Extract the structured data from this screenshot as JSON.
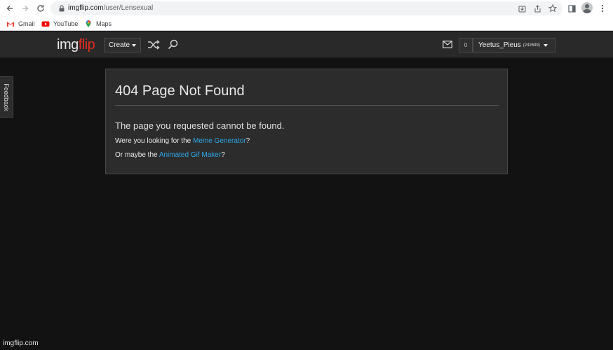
{
  "browser": {
    "url_domain": "imgflip.com",
    "url_path": "/user/Lensexual",
    "bookmarks": [
      {
        "label": "Gmail",
        "icon": "gmail-icon"
      },
      {
        "label": "YouTube",
        "icon": "youtube-icon"
      },
      {
        "label": "Maps",
        "icon": "maps-icon"
      }
    ]
  },
  "site": {
    "logo_img": "img",
    "logo_flip": "flip",
    "create_label": "Create",
    "notification_count": "0",
    "username": "Yeetus_Pieus",
    "user_points": "(242699)",
    "feedback_label": "Feedback",
    "colors": {
      "logo_red": "#e02d1e",
      "link_blue": "#2fa8e8",
      "background": "#121212",
      "header": "#292929"
    }
  },
  "error": {
    "title": "404 Page Not Found",
    "message": "The page you requested cannot be found.",
    "line1_prefix": "Were you looking for the ",
    "line1_link": "Meme Generator",
    "line1_suffix": "?",
    "line2_prefix": "Or maybe the ",
    "line2_link": "Animated Gif Maker",
    "line2_suffix": "?"
  },
  "watermark": "imgflip.com"
}
